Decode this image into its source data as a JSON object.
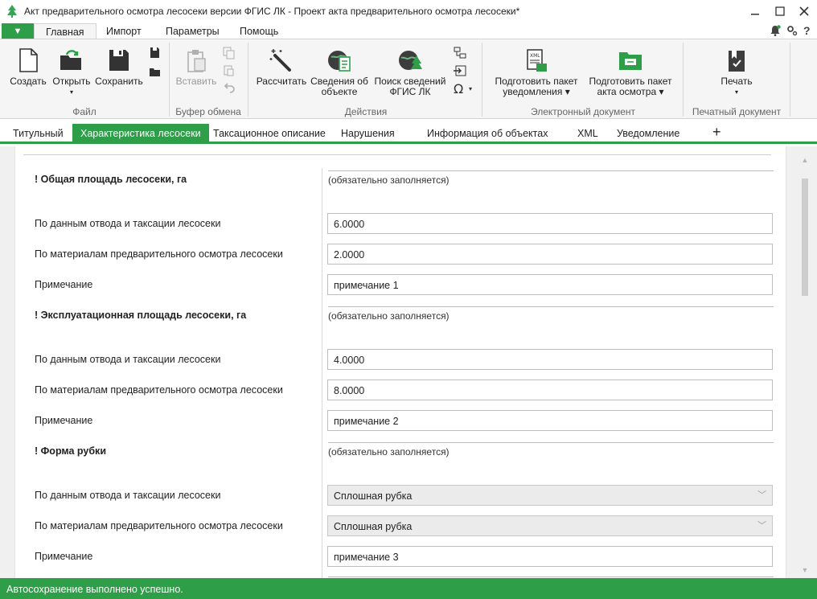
{
  "window": {
    "title": "Акт предварительного осмотра лесосеки версии ФГИС ЛК - Проект акта предварительного осмотра лесосеки*"
  },
  "ribbon_tabs": {
    "file_menu": "▼",
    "tabs": [
      "Главная",
      "Импорт",
      "Параметры",
      "Помощь"
    ]
  },
  "ribbon": {
    "file": {
      "create": "Создать",
      "open": "Открыть",
      "save": "Сохранить",
      "group": "Файл"
    },
    "clipboard": {
      "paste": "Вставить",
      "group": "Буфер обмена"
    },
    "actions": {
      "calc": "Рассчитать",
      "info1": "Сведения об",
      "info2": "объекте",
      "search1": "Поиск сведений",
      "search2": "ФГИС ЛК",
      "group": "Действия"
    },
    "edoc": {
      "prep_notice1": "Подготовить пакет",
      "prep_notice2": "уведомления",
      "prep_act1": "Подготовить пакет",
      "prep_act2": "акта осмотра",
      "group": "Электронный документ"
    },
    "print": {
      "print": "Печать",
      "group": "Печатный документ"
    }
  },
  "doc_tabs": [
    "Титульный",
    "Характеристика лесосеки",
    "Таксационное описание",
    "Нарушения",
    "Информация об объектах",
    "XML",
    "Уведомление",
    "+"
  ],
  "form": {
    "required_note": "(обязательно заполняется)",
    "sections": [
      {
        "title": "! Общая площадь лесосеки, га",
        "rows": [
          {
            "label": "По данным отвода и таксации лесосеки",
            "value": "6.0000"
          },
          {
            "label": "По материалам предварительного осмотра лесосеки",
            "value": "2.0000"
          },
          {
            "label": "Примечание",
            "value": "примечание 1"
          }
        ]
      },
      {
        "title": "! Эксплуатационная площадь лесосеки, га",
        "rows": [
          {
            "label": "По данным отвода и таксации лесосеки",
            "value": "4.0000"
          },
          {
            "label": "По материалам предварительного осмотра лесосеки",
            "value": "8.0000"
          },
          {
            "label": "Примечание",
            "value": "примечание 2"
          }
        ]
      },
      {
        "title": "! Форма рубки",
        "rows": [
          {
            "label": "По данным отвода и таксации лесосеки",
            "value": "Сплошная рубка"
          },
          {
            "label": "По материалам предварительного осмотра лесосеки",
            "value": "Сплошная рубка"
          },
          {
            "label": "Примечание",
            "value": "примечание 3"
          }
        ]
      }
    ]
  },
  "status": {
    "text": "Автосохранение выполнено успешно."
  },
  "colors": {
    "accent": "#2e9e49"
  }
}
